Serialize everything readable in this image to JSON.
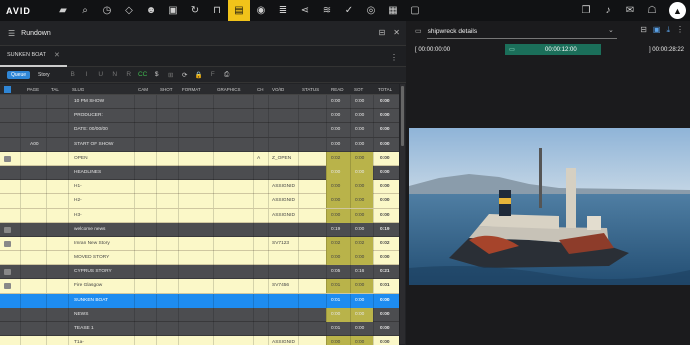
{
  "app": {
    "logo": "AVID",
    "user_initial": "▲"
  },
  "toolbar": {
    "icons": [
      "folder-icon",
      "search-icon",
      "clock-icon",
      "diamond-icon",
      "user-circle-icon",
      "box-icon",
      "refresh-icon",
      "bookmark-icon",
      "rundown-icon",
      "mpc-icon",
      "list-icon",
      "share-icon",
      "layers-icon",
      "check-icon",
      "globe-icon",
      "grid-icon",
      "box2-icon"
    ],
    "right_icons": [
      "stack-icon",
      "bell-icon",
      "chat-icon",
      "robot-icon"
    ]
  },
  "left_panel": {
    "title": "Rundown",
    "tab_label": "SUNKEN BOAT",
    "queue_label": "Queue",
    "story_label": "Story",
    "format_icons": [
      "B",
      "I",
      "U",
      "N",
      "R",
      "CC",
      "$",
      "⊞",
      "⟳",
      "🔒",
      "F",
      "⎙"
    ],
    "columns": [
      "PAGE",
      "TAL",
      "SLUG",
      "CAM",
      "SHOT",
      "FORMAT",
      "GRAPHICS",
      "CH",
      "VO/ID",
      "STATUS",
      "READ",
      "SOT",
      "TOTAL"
    ],
    "rows": [
      {
        "style": "dark",
        "icon": false,
        "page": "",
        "slug": "10 PM SHOW",
        "ch": "",
        "void": "",
        "read": "0:00",
        "sot": "0:00",
        "total": "0:00"
      },
      {
        "style": "dark",
        "icon": false,
        "page": "",
        "slug": "PRODUCER:",
        "ch": "",
        "void": "",
        "read": "0:00",
        "sot": "0:00",
        "total": "0:00"
      },
      {
        "style": "dark",
        "icon": false,
        "page": "",
        "slug": "DATE: 00/00/00",
        "ch": "",
        "void": "",
        "read": "0:00",
        "sot": "0:00",
        "total": "0:00"
      },
      {
        "style": "dark",
        "icon": false,
        "page": "A00",
        "slug": "START OF SHOW",
        "ch": "",
        "void": "",
        "read": "0:00",
        "sot": "0:00",
        "total": "0:00"
      },
      {
        "style": "light",
        "icon": true,
        "page": "",
        "slug": "OPEN",
        "ch": "A",
        "void": "Z_OPEN",
        "read": "0:02",
        "sot": "0:00",
        "total": "0:00"
      },
      {
        "style": "dark",
        "icon": false,
        "page": "",
        "slug": "HEADLINES",
        "ch": "",
        "void": "",
        "read": "0:00",
        "sot": "0:00",
        "total": "0:00"
      },
      {
        "style": "light",
        "icon": false,
        "page": "",
        "slug": "H1-",
        "ch": "",
        "void": "ASSIGNID",
        "read": "0:00",
        "sot": "0:00",
        "total": "0:00"
      },
      {
        "style": "light",
        "icon": false,
        "page": "",
        "slug": "H2-",
        "ch": "",
        "void": "ASSIGNID",
        "read": "0:00",
        "sot": "0:00",
        "total": "0:00"
      },
      {
        "style": "light",
        "icon": false,
        "page": "",
        "slug": "H3-",
        "ch": "",
        "void": "ASSIGNID",
        "read": "0:00",
        "sot": "0:00",
        "total": "0:00"
      },
      {
        "style": "dark",
        "icon": true,
        "page": "",
        "slug": "welcome news",
        "ch": "",
        "void": "",
        "read": "0:19",
        "sot": "0:00",
        "total": "0:19"
      },
      {
        "style": "light",
        "icon": true,
        "page": "",
        "slug": "Imran New Story",
        "ch": "",
        "void": "SV7123",
        "read": "0:02",
        "sot": "0:02",
        "total": "0:02"
      },
      {
        "style": "light",
        "icon": false,
        "page": "",
        "slug": "MOVED STORY",
        "ch": "",
        "void": "",
        "read": "0:00",
        "sot": "0:00",
        "total": "0:00"
      },
      {
        "style": "dark",
        "icon": true,
        "page": "",
        "slug": "CYPRUS STORY",
        "ch": "",
        "void": "",
        "read": "0:05",
        "sot": "0:16",
        "total": "0:21"
      },
      {
        "style": "light",
        "icon": true,
        "page": "",
        "slug": "Fire Glasgow",
        "ch": "",
        "void": "SV7456",
        "read": "0:01",
        "sot": "0:00",
        "total": "0:01"
      },
      {
        "style": "sel",
        "icon": false,
        "page": "",
        "slug": "SUNKEN BOAT",
        "ch": "",
        "void": "",
        "read": "0:01",
        "sot": "0:00",
        "total": "0:00"
      },
      {
        "style": "dark",
        "icon": false,
        "page": "",
        "slug": "NEWS",
        "ch": "",
        "void": "",
        "read": "0:00",
        "sot": "0:00",
        "total": "0:00"
      },
      {
        "style": "dark",
        "icon": false,
        "page": "",
        "slug": "TEASE 1",
        "ch": "",
        "void": "",
        "read": "0:01",
        "sot": "0:00",
        "total": "0:00"
      },
      {
        "style": "light",
        "icon": false,
        "page": "",
        "slug": "T1a-",
        "ch": "",
        "void": "ASSIGNID",
        "read": "0:00",
        "sot": "0:00",
        "total": "0:00"
      }
    ]
  },
  "right_panel": {
    "title": "shipwreck details",
    "tc_in": "00:00:00:00",
    "tc_mid": "00:00:12:00",
    "tc_out": "00:00:28:22"
  },
  "colors": {
    "accent_yellow": "#f1c31a",
    "select_blue": "#1e8cf0",
    "row_light": "#fbf8c8",
    "row_dark": "#4c4d50",
    "olive_cell": "#b9b34a",
    "timecode_green": "#1b6f5a"
  }
}
